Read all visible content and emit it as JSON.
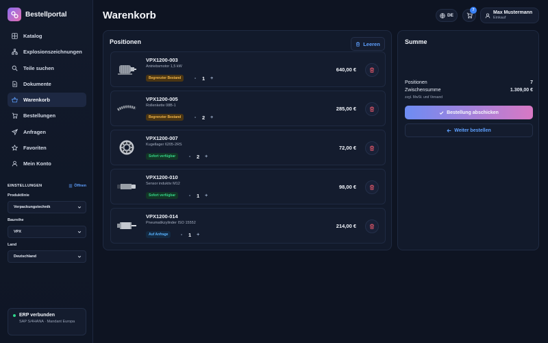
{
  "app": {
    "name": "Bestellportal"
  },
  "nav": [
    {
      "label": "Katalog",
      "icon": "grid-icon"
    },
    {
      "label": "Explosionszeichnungen",
      "icon": "hierarchy-icon"
    },
    {
      "label": "Teile suchen",
      "icon": "search-icon"
    },
    {
      "label": "Dokumente",
      "icon": "document-icon"
    },
    {
      "label": "Warenkorb",
      "icon": "basket-icon",
      "active": true
    },
    {
      "label": "Bestellungen",
      "icon": "cart-icon"
    },
    {
      "label": "Anfragen",
      "icon": "send-icon"
    },
    {
      "label": "Favoriten",
      "icon": "star-icon"
    },
    {
      "label": "Mein Konto",
      "icon": "user-icon"
    }
  ],
  "settings": {
    "title": "EINSTELLUNGEN",
    "open_label": "Öffnen",
    "fields": [
      {
        "label": "Produktlinie",
        "value": "Verpackungstechnik"
      },
      {
        "label": "Baureihe",
        "value": "VPX"
      },
      {
        "label": "Land",
        "value": "Deutschland"
      }
    ]
  },
  "erp": {
    "title": "ERP verbunden",
    "subtitle": "SAP S/4HANA · Mandant Europa",
    "status_color": "#2fd58b"
  },
  "header": {
    "title": "Warenkorb",
    "language": "DE",
    "cart_count": "7",
    "user_name": "Max Mustermann",
    "user_role": "Einkauf"
  },
  "positions": {
    "title": "Positionen",
    "clear_label": "Leeren",
    "items": [
      {
        "sku": "VPX1200-003",
        "description": "Antriebsmotor 1,5 kW",
        "availability": "Begrenzter Bestand",
        "status": "warn",
        "qty": "1",
        "price": "640,00 €",
        "image": "motor-image"
      },
      {
        "sku": "VPX1200-005",
        "description": "Rollenkette 08B-1",
        "availability": "Begrenzter Bestand",
        "status": "warn",
        "qty": "2",
        "price": "285,00 €",
        "image": "chain-image"
      },
      {
        "sku": "VPX1200-007",
        "description": "Kugellager 6205-2RS",
        "availability": "Sofort verfügbar",
        "status": "ok",
        "qty": "2",
        "price": "72,00 €",
        "image": "bearing-image"
      },
      {
        "sku": "VPX1200-010",
        "description": "Sensor induktiv M12",
        "availability": "Sofort verfügbar",
        "status": "ok",
        "qty": "1",
        "price": "98,00 €",
        "image": "sensor-image"
      },
      {
        "sku": "VPX1200-014",
        "description": "Pneumatikzylinder ISO 15552",
        "availability": "Auf Anfrage",
        "status": "info",
        "qty": "1",
        "price": "214,00 €",
        "image": "cylinder-image"
      }
    ],
    "qty_minus": "-",
    "qty_plus": "+"
  },
  "summary": {
    "title": "Summe",
    "positions_label": "Positionen",
    "positions_value": "7",
    "subtotal_label": "Zwischensumme",
    "subtotal_value": "1.309,00 €",
    "note": "zzgl. MwSt. und Versand",
    "checkout_label": "Bestellung abschicken",
    "continue_label": "Weiter bestellen"
  }
}
